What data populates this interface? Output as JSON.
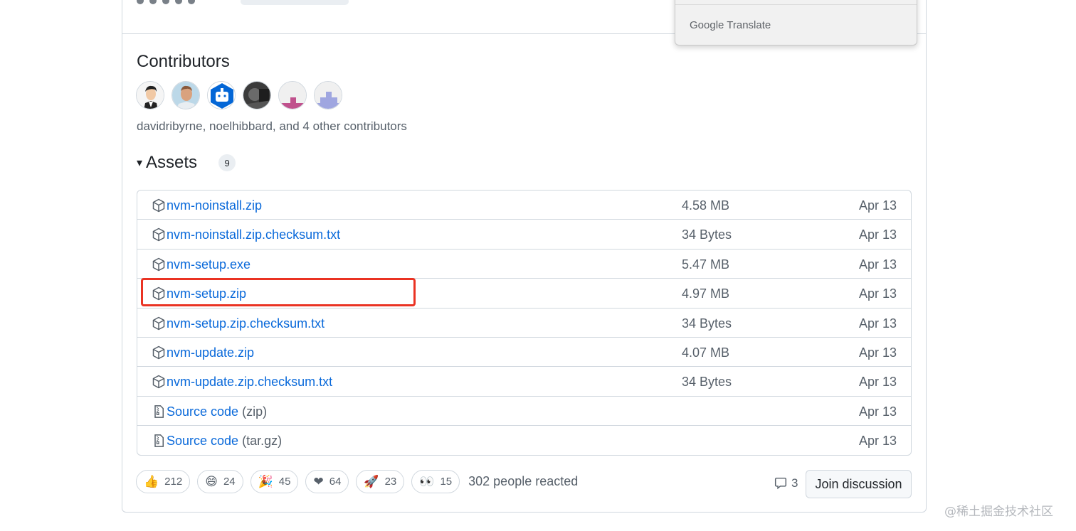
{
  "translate_popup": {
    "label": "Google Translate"
  },
  "contributors": {
    "title": "Contributors",
    "avatars": [
      "avatar-cartoon",
      "avatar-photo",
      "avatar-bot",
      "avatar-dark",
      "avatar-pink",
      "avatar-purple"
    ],
    "text": "davidribyrne, noelhibbard, and 4 other contributors"
  },
  "assets": {
    "title": "Assets",
    "count": "9",
    "rows": [
      {
        "name": "nvm-noinstall.zip",
        "suffix": "",
        "size": "4.58 MB",
        "date": "Apr 13",
        "icon": "package-icon"
      },
      {
        "name": "nvm-noinstall.zip.checksum.txt",
        "suffix": "",
        "size": "34 Bytes",
        "date": "Apr 13",
        "icon": "package-icon"
      },
      {
        "name": "nvm-setup.exe",
        "suffix": "",
        "size": "5.47 MB",
        "date": "Apr 13",
        "icon": "package-icon"
      },
      {
        "name": "nvm-setup.zip",
        "suffix": "",
        "size": "4.97 MB",
        "date": "Apr 13",
        "icon": "package-icon"
      },
      {
        "name": "nvm-setup.zip.checksum.txt",
        "suffix": "",
        "size": "34 Bytes",
        "date": "Apr 13",
        "icon": "package-icon"
      },
      {
        "name": "nvm-update.zip",
        "suffix": "",
        "size": "4.07 MB",
        "date": "Apr 13",
        "icon": "package-icon"
      },
      {
        "name": "nvm-update.zip.checksum.txt",
        "suffix": "",
        "size": "34 Bytes",
        "date": "Apr 13",
        "icon": "package-icon"
      },
      {
        "name": "Source code",
        "suffix": "(zip)",
        "size": "",
        "date": "Apr 13",
        "icon": "file-zip-icon"
      },
      {
        "name": "Source code",
        "suffix": "(tar.gz)",
        "size": "",
        "date": "Apr 13",
        "icon": "file-zip-icon"
      }
    ]
  },
  "reactions": {
    "items": [
      {
        "emoji": "👍",
        "count": "212",
        "icon": "thumbs-up-icon"
      },
      {
        "emoji": "😄",
        "count": "24",
        "icon": "laugh-icon"
      },
      {
        "emoji": "🎉",
        "count": "45",
        "icon": "hooray-icon"
      },
      {
        "emoji": "❤",
        "count": "64",
        "icon": "heart-icon"
      },
      {
        "emoji": "🚀",
        "count": "23",
        "icon": "rocket-icon"
      },
      {
        "emoji": "👀",
        "count": "15",
        "icon": "eyes-icon"
      }
    ],
    "summary": "302 people reacted"
  },
  "discussion": {
    "comment_count": "3",
    "join_label": "Join discussion"
  },
  "watermark": "@稀土掘金技术社区",
  "colors": {
    "link": "#0969da",
    "muted": "#57606a",
    "highlight": "#ea3323",
    "border": "#d0d7de"
  }
}
